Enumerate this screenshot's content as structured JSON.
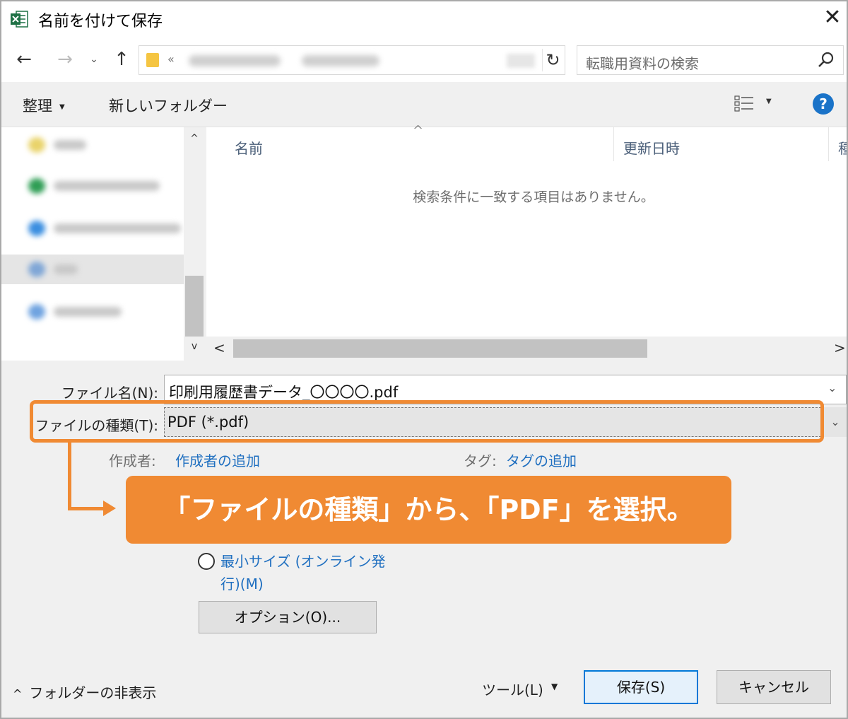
{
  "window": {
    "title": "名前を付けて保存",
    "close_glyph": "✕"
  },
  "nav": {
    "back_glyph": "←",
    "forward_glyph": "→",
    "history_glyph": "⌄",
    "up_glyph": "↑",
    "address_chevron": "«",
    "refresh_glyph": "↻",
    "search_placeholder": "転職用資料の検索"
  },
  "toolbar": {
    "organize_label": "整理",
    "organize_caret": "▼",
    "new_folder_label": "新しいフォルダー",
    "view_caret": "▼",
    "help_glyph": "?"
  },
  "file_list": {
    "sort_glyph": "^",
    "columns": [
      "名前",
      "更新日時",
      "種"
    ],
    "empty_message": "検索条件に一致する項目はありません。"
  },
  "scroll": {
    "up": "^",
    "down": "v",
    "left": "<",
    "right": ">"
  },
  "form": {
    "filename_label": "ファイル名(N):",
    "filename_value": "印刷用履歴書データ_〇〇〇〇.pdf",
    "filetype_label": "ファイルの種類(T):",
    "filetype_value": "PDF (*.pdf)",
    "dropdown_glyph": "⌄",
    "author_label": "作成者:",
    "author_link": "作成者の追加",
    "tags_label": "タグ:",
    "tags_link": "タグの追加"
  },
  "callout": {
    "text": "「ファイルの種類」から、「PDF」を選択。"
  },
  "options": {
    "min_size_line1": "最小サイズ (オンライン発",
    "min_size_line2": "行)(M)",
    "options_button": "オプション(O)..."
  },
  "footer": {
    "hide_folders_caret": "^",
    "hide_folders_label": "フォルダーの非表示",
    "tools_label": "ツール(L)",
    "tools_caret": "▼",
    "save_label": "保存(S)",
    "cancel_label": "キャンセル"
  },
  "colors": {
    "accent_orange": "#f08a33",
    "link_blue": "#1f6fc0",
    "excel_green": "#1e7145",
    "help_blue": "#1a73c8"
  }
}
